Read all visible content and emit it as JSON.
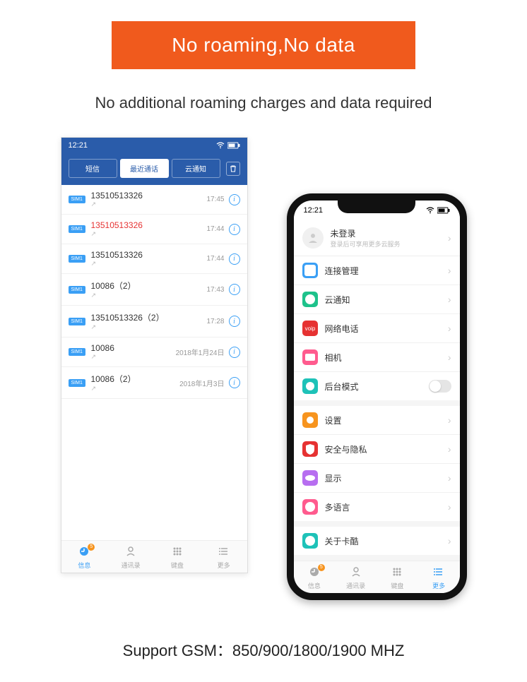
{
  "banner": "No roaming,No data",
  "subtitle": "No additional roaming charges and data required",
  "footer": "Support GSM：850/900/1800/1900 MHZ",
  "left": {
    "time": "12:21",
    "tabs": [
      "短信",
      "最近通话",
      "云通知"
    ],
    "calls": [
      {
        "sim": "SIM1",
        "num": "13510513326",
        "missed": false,
        "time": "17:45"
      },
      {
        "sim": "SIM1",
        "num": "13510513326",
        "missed": true,
        "time": "17:44"
      },
      {
        "sim": "SIM1",
        "num": "13510513326",
        "missed": false,
        "time": "17:44"
      },
      {
        "sim": "SIM1",
        "num": "10086（2）",
        "missed": false,
        "time": "17:43"
      },
      {
        "sim": "SIM1",
        "num": "13510513326（2）",
        "missed": false,
        "time": "17:28"
      },
      {
        "sim": "SIM1",
        "num": "10086",
        "missed": false,
        "time": "2018年1月24日"
      },
      {
        "sim": "SIM1",
        "num": "10086（2）",
        "missed": false,
        "time": "2018年1月3日"
      }
    ],
    "nav": [
      "信息",
      "通讯录",
      "键盘",
      "更多"
    ],
    "badge": "5"
  },
  "right": {
    "time": "12:21",
    "login_title": "未登录",
    "login_sub": "登录后可享用更多云服务",
    "groups": [
      [
        {
          "label": "连接管理",
          "color": "#3a9ff5",
          "icon": "link",
          "chev": true
        },
        {
          "label": "云通知",
          "color": "#1ec28b",
          "icon": "msg",
          "chev": true
        },
        {
          "label": "网络电话",
          "color": "#e63232",
          "icon": "voip",
          "chev": true
        },
        {
          "label": "相机",
          "color": "#ff5b8e",
          "icon": "cam",
          "chev": true
        },
        {
          "label": "后台模式",
          "color": "#1ec2b8",
          "icon": "bg",
          "toggle": true
        }
      ],
      [
        {
          "label": "设置",
          "color": "#f7941e",
          "icon": "gear",
          "chev": true
        },
        {
          "label": "安全与隐私",
          "color": "#e63232",
          "icon": "shield",
          "chev": true
        },
        {
          "label": "显示",
          "color": "#b76ef0",
          "icon": "eye",
          "chev": true
        },
        {
          "label": "多语言",
          "color": "#ff5b8e",
          "icon": "lang",
          "chev": true
        }
      ],
      [
        {
          "label": "关于卡酷",
          "color": "#1ec2b8",
          "icon": "info",
          "chev": true
        }
      ]
    ],
    "nav": [
      "信息",
      "通讯录",
      "键盘",
      "更多"
    ],
    "badge": "5"
  }
}
